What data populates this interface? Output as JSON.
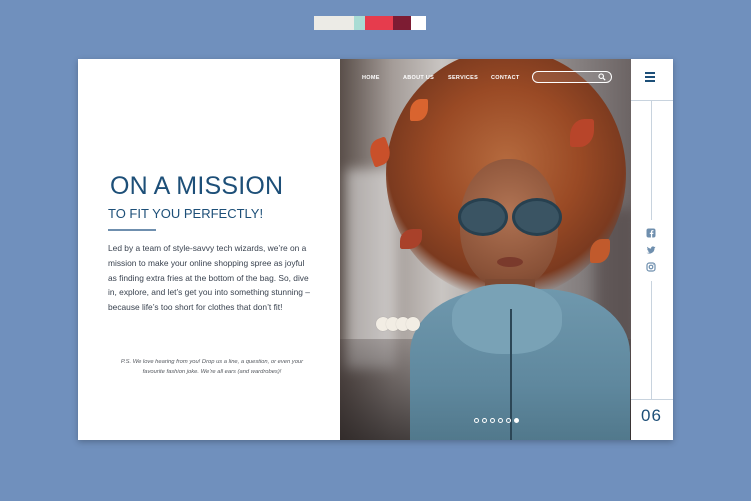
{
  "palette": [
    "#ecebe6",
    "#a9dcd4",
    "#e63c4d",
    "#7d1c33",
    "#ffffff"
  ],
  "nav": {
    "items": [
      "HOME",
      "ABOUT US",
      "SERVICES",
      "CONTACT"
    ],
    "search_placeholder": ""
  },
  "hero": {
    "title": "ON A MISSION",
    "subtitle": "TO FIT YOU PERFECTLY!",
    "body": "Led by a team of style-savvy tech wizards, we’re on a mission to make your online shopping spree as joyful as finding extra fries at the bottom of the bag. So, dive in, explore, and let’s get you into something stunning – because life’s too short for clothes that don’t fit!",
    "ps": "P.S. We love hearing from you! Drop us a line, a question, or even your favourite fashion joke. We’re all ears (and wardrobes)!"
  },
  "carousel": {
    "slide_count": 6,
    "active_index": 6
  },
  "rail": {
    "social": [
      "facebook-icon",
      "twitter-icon",
      "instagram-icon"
    ],
    "page_number": "06"
  },
  "colors": {
    "accent": "#1d4f78",
    "background": "#7090bd"
  }
}
